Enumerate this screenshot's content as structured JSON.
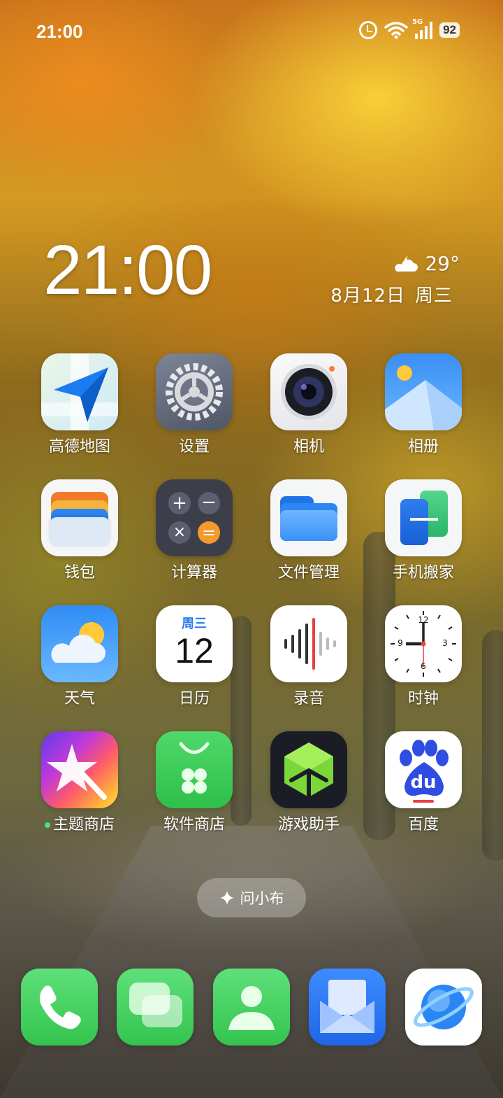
{
  "status_bar": {
    "time": "21:00",
    "network_label": "5G",
    "battery": "92",
    "icons": [
      "alarm-icon",
      "wifi-icon",
      "signal-icon",
      "battery-icon"
    ]
  },
  "widget": {
    "time": "21:00",
    "weather_icon": "partly-cloudy-night-icon",
    "temperature": "29°",
    "date": "8月12日",
    "weekday": "周三"
  },
  "apps": [
    {
      "label": "高德地图",
      "icon": "navigation-arrow-icon"
    },
    {
      "label": "设置",
      "icon": "gear-icon"
    },
    {
      "label": "相机",
      "icon": "camera-lens-icon"
    },
    {
      "label": "相册",
      "icon": "photo-mountain-icon"
    },
    {
      "label": "钱包",
      "icon": "wallet-cards-icon"
    },
    {
      "label": "计算器",
      "icon": "calculator-icon"
    },
    {
      "label": "文件管理",
      "icon": "folder-icon"
    },
    {
      "label": "手机搬家",
      "icon": "phone-transfer-icon"
    },
    {
      "label": "天气",
      "icon": "sun-cloud-icon"
    },
    {
      "label": "日历",
      "icon": "calendar-icon",
      "calendar_weekday": "周三",
      "calendar_day": "12"
    },
    {
      "label": "录音",
      "icon": "sound-wave-icon"
    },
    {
      "label": "时钟",
      "icon": "analog-clock-icon",
      "clock_numbers": [
        "12",
        "3",
        "6",
        "9"
      ]
    },
    {
      "label": "主题商店",
      "icon": "star-wand-icon",
      "has_update_dot": true
    },
    {
      "label": "软件商店",
      "icon": "shopping-bag-icon"
    },
    {
      "label": "游戏助手",
      "icon": "game-cube-icon"
    },
    {
      "label": "百度",
      "icon": "baidu-paw-icon",
      "icon_text": "du"
    }
  ],
  "assistant": {
    "label": "问小布",
    "icon": "sparkle-icon"
  },
  "dock": [
    {
      "icon": "phone-icon"
    },
    {
      "icon": "messages-icon"
    },
    {
      "icon": "contacts-icon"
    },
    {
      "icon": "mail-icon"
    },
    {
      "icon": "browser-planet-icon"
    }
  ]
}
